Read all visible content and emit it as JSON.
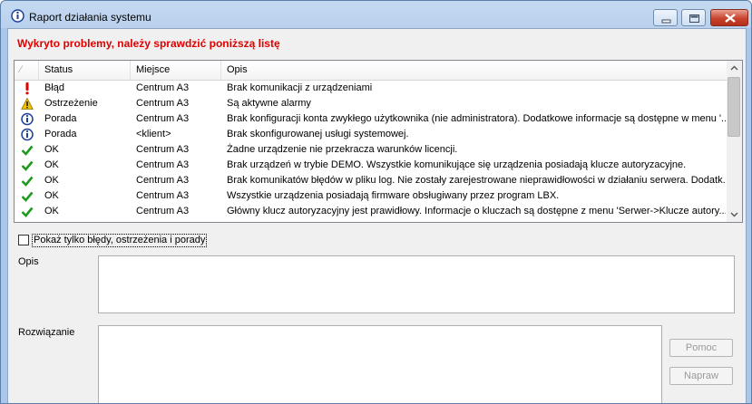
{
  "window": {
    "title": "Raport działania systemu"
  },
  "headline": "Wykryto problemy, należy sprawdzić poniższą listę",
  "list": {
    "sort_glyph": "⁄",
    "columns": [
      "Status",
      "Miejsce",
      "Opis"
    ],
    "rows": [
      {
        "icon": "error-icon",
        "status": "Błąd",
        "place": "Centrum A3",
        "desc": "Brak komunikacji z urządzeniami"
      },
      {
        "icon": "warning-icon",
        "status": "Ostrzeżenie",
        "place": "Centrum A3",
        "desc": "Są aktywne alarmy"
      },
      {
        "icon": "info-icon",
        "status": "Porada",
        "place": "Centrum A3",
        "desc": "Brak konfiguracji konta zwykłego użytkownika (nie administratora). Dodatkowe informacje są dostępne w menu '..."
      },
      {
        "icon": "info-icon",
        "status": "Porada",
        "place": "<klient>",
        "desc": "Brak skonfigurowanej usługi systemowej."
      },
      {
        "icon": "check-icon",
        "status": "OK",
        "place": "Centrum A3",
        "desc": "Żadne urządzenie nie przekracza warunków licencji."
      },
      {
        "icon": "check-icon",
        "status": "OK",
        "place": "Centrum A3",
        "desc": "Brak urządzeń w trybie DEMO. Wszystkie komunikujące się urządzenia posiadają klucze autoryzacyjne."
      },
      {
        "icon": "check-icon",
        "status": "OK",
        "place": "Centrum A3",
        "desc": "Brak komunikatów błędów w pliku log. Nie zostały zarejestrowane nieprawidłowości w działaniu serwera. Dodatk..."
      },
      {
        "icon": "check-icon",
        "status": "OK",
        "place": "Centrum A3",
        "desc": "Wszystkie urządzenia posiadają firmware obsługiwany przez program LBX."
      },
      {
        "icon": "check-icon",
        "status": "OK",
        "place": "Centrum A3",
        "desc": "Główny klucz autoryzacyjny jest prawidłowy. Informacje o kluczach są dostępne z menu 'Serwer->Klucze autory..."
      }
    ]
  },
  "filter_checkbox": {
    "label": "Pokaż tylko błędy, ostrzeżenia i porady",
    "checked": false
  },
  "description_label": "Opis",
  "solution_label": "Rozwiązanie",
  "buttons": {
    "help": "Pomoc",
    "fix": "Napraw"
  },
  "colors": {
    "headline": "#e00000",
    "error": "#e00000",
    "warning": "#f2c200",
    "check": "#1e9b1e",
    "info": "#1c3f9b"
  }
}
